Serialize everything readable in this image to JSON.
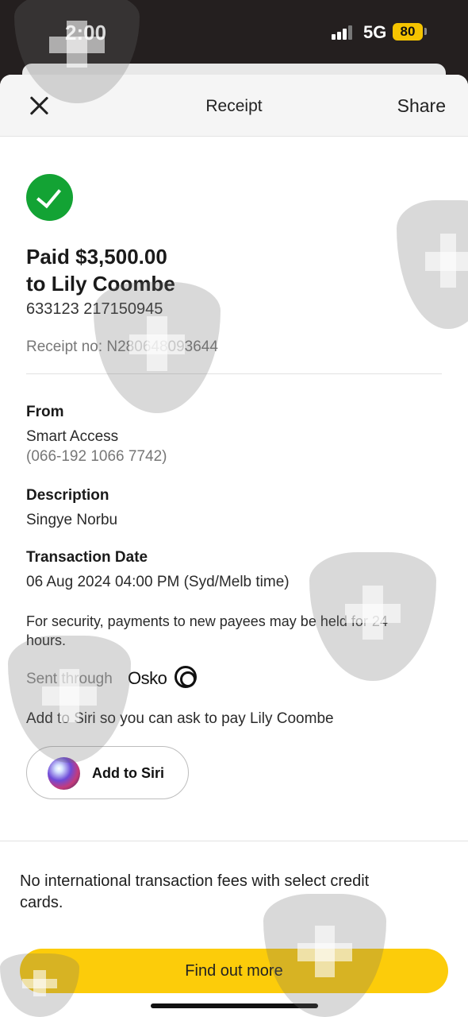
{
  "status_bar": {
    "time": "2:00",
    "network": "5G",
    "battery": "80"
  },
  "nav": {
    "title": "Receipt",
    "share_label": "Share"
  },
  "receipt": {
    "paid_line": "Paid $3,500.00",
    "payee_line": "to Lily Coombe",
    "account": "633123 217150945",
    "receipt_no": "Receipt no: N280648093644"
  },
  "from": {
    "label": "From",
    "account_name": "Smart Access",
    "account_number": "(066-192 1066 7742)"
  },
  "description": {
    "label": "Description",
    "value": "Singye Norbu"
  },
  "transaction_date": {
    "label": "Transaction Date",
    "value": "06 Aug 2024 04:00 PM (Syd/Melb time)"
  },
  "security_notice": "For security, payments to new payees may be held for 24 hours.",
  "sent_through": {
    "label": "Sent through",
    "brand": "Osko",
    "icon": "osko-logo-icon"
  },
  "siri": {
    "prompt": "Add to Siri so you can ask to pay Lily Coombe",
    "button_label": "Add to Siri",
    "icon": "siri-icon"
  },
  "promo": {
    "text": "No international transaction fees with select credit cards.",
    "button_label": "Find out more"
  },
  "colors": {
    "accent": "#fccc0a",
    "success": "#13a334",
    "badge": "#f5c400"
  }
}
